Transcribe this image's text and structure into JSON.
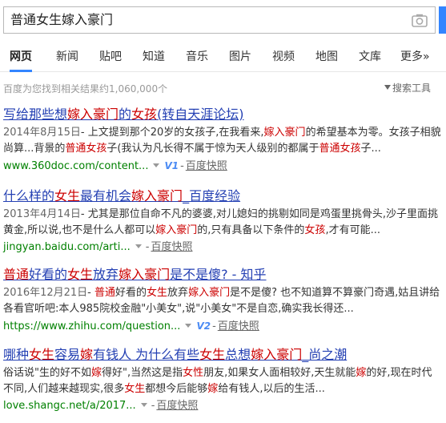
{
  "search": {
    "query": "普通女生嫁入豪门"
  },
  "tabs": [
    {
      "label": "网页",
      "active": true
    },
    {
      "label": "新闻"
    },
    {
      "label": "贴吧"
    },
    {
      "label": "知道"
    },
    {
      "label": "音乐"
    },
    {
      "label": "图片"
    },
    {
      "label": "视频"
    },
    {
      "label": "地图"
    },
    {
      "label": "文库"
    },
    {
      "label": "更多»"
    }
  ],
  "result_count": "百度为您找到相关结果约1,060,000个",
  "tools_label": "搜索工具",
  "results": [
    {
      "title": [
        "写给那些想",
        "嫁入豪门",
        "的",
        "女孩",
        "(转自天涯论坛)"
      ],
      "date": "2014年8月15日",
      "abstract_line1": [
        "- 上文提到那个20岁的女孩子,在我看来,",
        "嫁入豪门",
        "的希望基本为零。女孩子相貌"
      ],
      "abstract_line2": [
        "尚算...背景的",
        "普通女孩",
        "子(我认为凡长得不属于惊为天人级别的都属于",
        "普通女孩",
        "子..."
      ],
      "url": "www.360doc.com/content...",
      "badge": "V1",
      "snapshot": "百度快照"
    },
    {
      "title": [
        "什么样的",
        "女生",
        "最有机会",
        "嫁入豪门",
        "_百度经验"
      ],
      "date": "2013年4月14日",
      "abstract_line1": [
        "- 尤其是那位自命不凡的婆婆,对儿媳妇的挑剔如同是鸡蛋里挑骨头,沙子里面挑"
      ],
      "abstract_line2": [
        "黄金,所以说,也不是什么人都可以",
        "嫁入豪门",
        "的,只有具备以下条件的",
        "女孩",
        ",才有可能..."
      ],
      "url": "jingyan.baidu.com/arti...",
      "snapshot": "百度快照"
    },
    {
      "title": [
        "普通",
        "好看的",
        "女生",
        "放弃",
        "嫁入豪门",
        "是不是傻? - 知乎"
      ],
      "date": "2016年12月21日",
      "abstract_line1": [
        "- ",
        "普通",
        "好看的",
        "女生",
        "放弃",
        "嫁入豪门",
        "是不是傻? 也不知道算不算豪门奇遇,姑且讲给"
      ],
      "abstract_line2": [
        "各看官听吧:本人985院校金融\"小美女\",说\"小美女\"不是自恋,确实我长得还..."
      ],
      "url": "https://www.zhihu.com/question...",
      "badge": "V2",
      "snapshot": "百度快照"
    },
    {
      "title": [
        "哪种",
        "女生",
        "容易",
        "嫁",
        "有钱人 为什么有些",
        "女生",
        "总想",
        "嫁入豪门",
        "_尚之潮"
      ],
      "abstract_line1": [
        "俗话说\"生的好不如",
        "嫁",
        "得好\",当然这是指",
        "女性",
        "朋友,如果女人面相较好,天生就能",
        "嫁",
        "的好,现在时代"
      ],
      "abstract_line2": [
        "不同,人们越来越现实,很多",
        "女生",
        "都想今后能够",
        "嫁",
        "给有钱人,以后的生活..."
      ],
      "url": "love.shangc.net/a/2017...",
      "snapshot": "百度快照"
    }
  ]
}
